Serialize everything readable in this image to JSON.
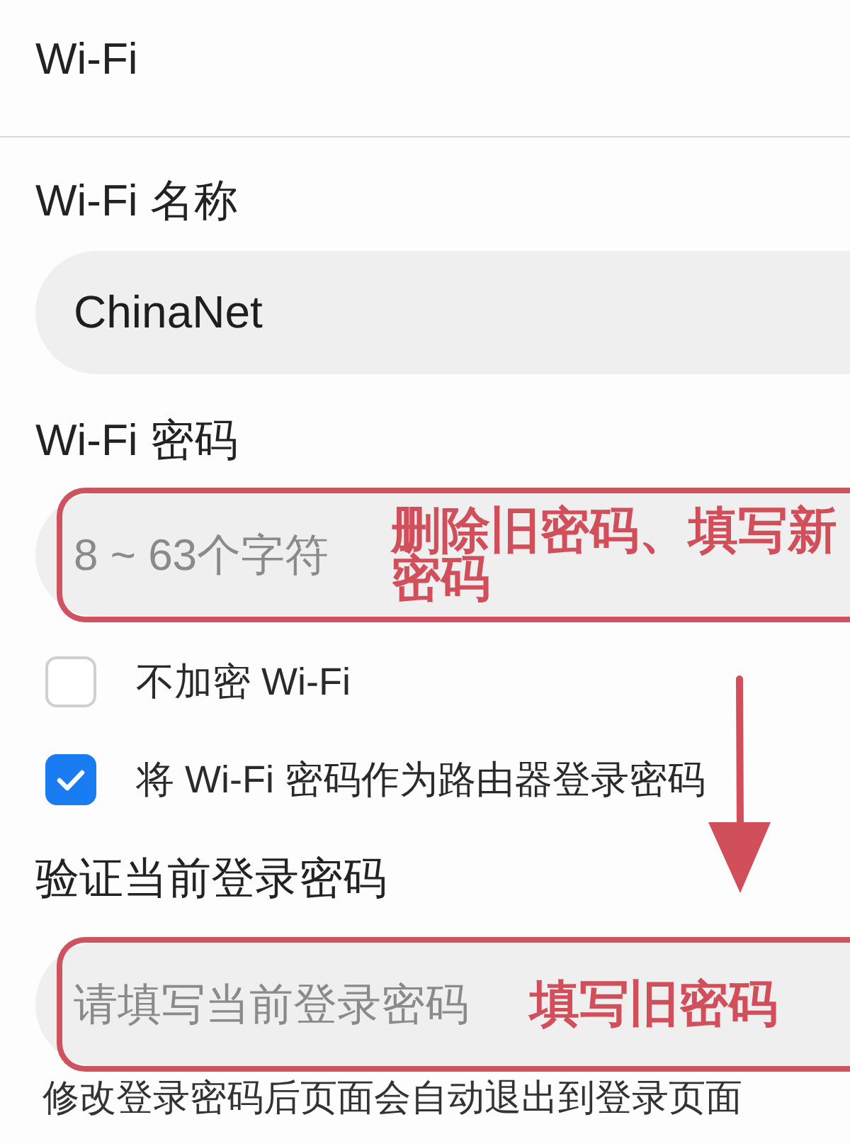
{
  "header": {
    "title": "Wi-Fi"
  },
  "wifi_name": {
    "label": "Wi-Fi 名称",
    "value": "ChinaNet"
  },
  "wifi_password": {
    "label": "Wi-Fi 密码",
    "placeholder": "8 ~ 63个字符",
    "callout": "删除旧密码、填写新密码"
  },
  "options": [
    {
      "label": "不加密 Wi-Fi",
      "checked": false
    },
    {
      "label": "将 Wi-Fi 密码作为路由器登录密码",
      "checked": true
    }
  ],
  "verify_password": {
    "label": "验证当前登录密码",
    "placeholder": "请填写当前登录密码",
    "callout": "填写旧密码"
  },
  "note": "修改登录密码后页面会自动退出到登录页面"
}
